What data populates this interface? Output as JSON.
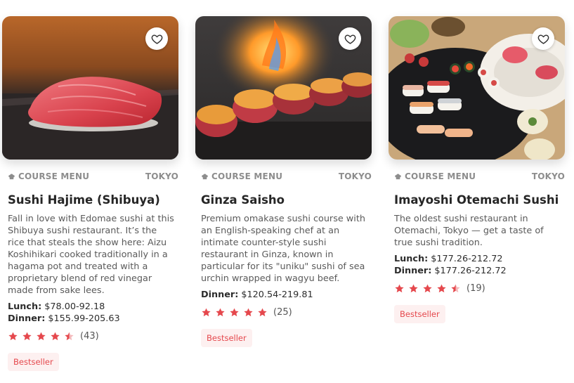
{
  "colors": {
    "accent": "#e5484d",
    "badge_bg": "#fdf0f0",
    "muted": "#8d8d8d"
  },
  "cards": [
    {
      "category": "COURSE MENU",
      "location": "TOKYO",
      "name": "Sushi Hajime (Shibuya)",
      "description": "Fall in love with Edomae sushi at this Shibuya sushi restaurant. It’s the rice that steals the show here: Aizu Koshihikari cooked traditionally in a hagama pot and treated with a proprietary blend of red vinegar made from sake lees.",
      "prices": [
        {
          "label": "Lunch:",
          "value": "$78.00-92.18"
        },
        {
          "label": "Dinner:",
          "value": "$155.99-205.63"
        }
      ],
      "rating": 4.5,
      "reviews": "(43)",
      "badge": "Bestseller",
      "image_icon": "tuna-nigiri-photo"
    },
    {
      "category": "COURSE MENU",
      "location": "TOKYO",
      "name": "Ginza Saisho",
      "description": "Premium omakase sushi course with an English-speaking chef at an intimate counter-style sushi restaurant in Ginza, known in particular for its \"uniku\" sushi of sea urchin wrapped in wagyu beef.",
      "prices": [
        {
          "label": "Dinner:",
          "value": "$120.54-219.81"
        }
      ],
      "rating": 5,
      "reviews": "(25)",
      "badge": "Bestseller",
      "image_icon": "uniku-sushi-photo"
    },
    {
      "category": "COURSE MENU",
      "location": "TOKYO",
      "name": "Imayoshi Otemachi Sushi",
      "description": "The oldest sushi restaurant in Otemachi, Tokyo — get a taste of true sushi tradition.",
      "prices": [
        {
          "label": "Lunch:",
          "value": "$177.26-212.72"
        },
        {
          "label": "Dinner:",
          "value": "$177.26-212.72"
        }
      ],
      "rating": 4.5,
      "reviews": "(19)",
      "badge": "Bestseller",
      "image_icon": "sushi-platter-photo"
    }
  ]
}
